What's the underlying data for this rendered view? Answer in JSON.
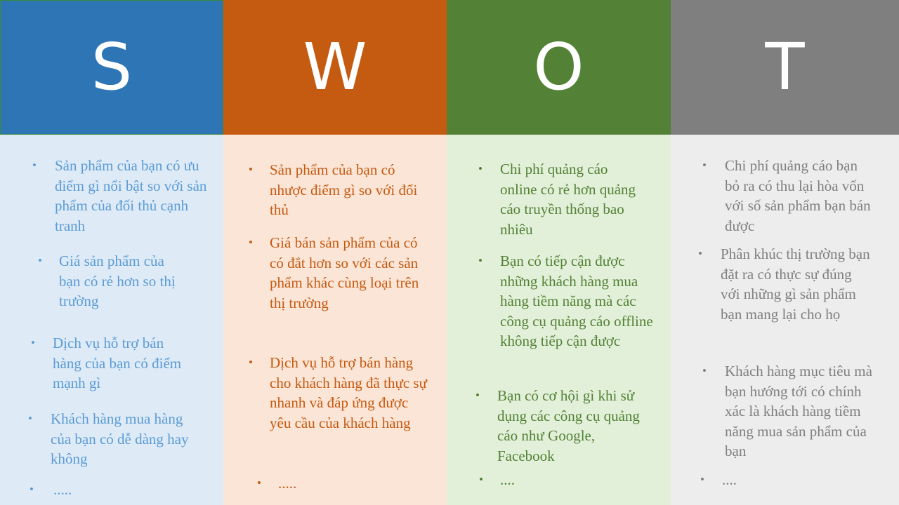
{
  "columns": [
    {
      "letter": "S",
      "items": [
        "Sản phẩm của bạn có ưu điểm gì nổi bật so với sản phẩm của đối thủ cạnh tranh",
        "Giá sản phẩm của bạn có rẻ hơn so thị trường",
        "Dịch vụ hỗ trợ bán hàng của bạn có điểm mạnh gì",
        "Khách hàng mua hàng của bạn có dễ dàng hay không",
        "....."
      ]
    },
    {
      "letter": "W",
      "items": [
        "Sản phẩm của bạn có nhược điểm gì so với đối thủ",
        "Giá bán sản phẩm của có có đắt hơn so với các sản phẩm khác cùng loại trên thị trường",
        "Dịch vụ hỗ trợ bán hàng cho khách hàng đã thực sự nhanh và đáp ứng được yêu cầu của khách hàng",
        "....."
      ]
    },
    {
      "letter": "O",
      "items": [
        "Chi phí quảng cáo online có rẻ hơn quảng cáo truyền thống bao nhiêu",
        "Bạn có tiếp cận được những khách hàng mua hàng tiềm năng mà các công cụ quảng cáo offline không tiếp cận được",
        "Bạn có cơ hội gì khi sử dụng các công cụ quảng cáo như Google, Facebook",
        "...."
      ]
    },
    {
      "letter": "T",
      "items": [
        "Chi phí quảng cáo bạn bỏ ra có thu lại hòa vốn với số sản phẩm bạn bán được",
        "Phân khúc thị trường bạn đặt ra có thực sự đúng với những gì sản phẩm bạn mang lại cho họ",
        "Khách hàng mục tiêu mà bạn hướng tới có chính xác là khách hàng tiềm năng mua sản phẩm của bạn",
        "...."
      ]
    }
  ],
  "bullet_glyph": "•",
  "colors": {
    "s_header": "#2e75b6",
    "w_header": "#c55a11",
    "o_header": "#538135",
    "t_header": "#7f7f7f",
    "s_body": "#deebf7",
    "w_body": "#fbe5d6",
    "o_body": "#e2f0d9",
    "t_body": "#ededed",
    "s_text": "#5b9bd5",
    "w_text": "#c55a11",
    "o_text": "#538135",
    "t_text": "#7f7f7f"
  }
}
